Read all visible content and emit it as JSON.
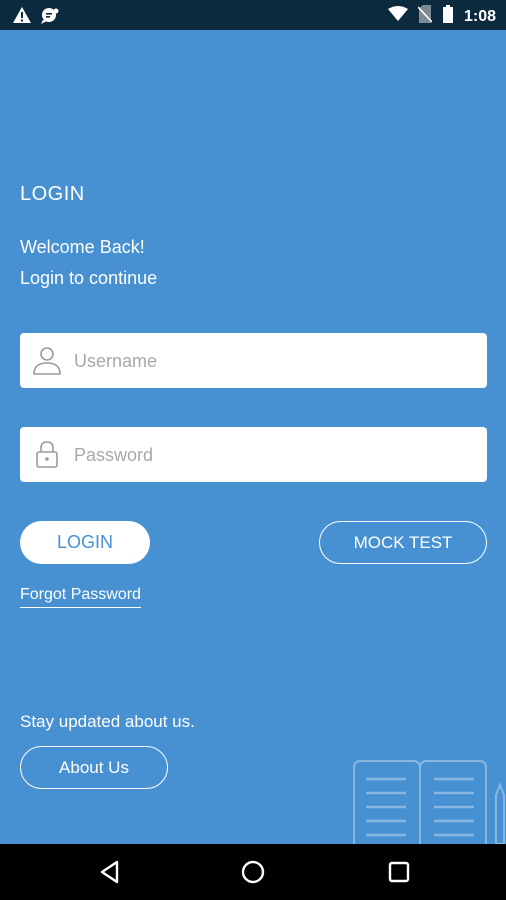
{
  "status_bar": {
    "time": "1:08",
    "icons": [
      "warning-icon",
      "notification-icon",
      "wifi-icon",
      "no-sim-icon",
      "battery-icon"
    ]
  },
  "login": {
    "title": "LOGIN",
    "welcome": "Welcome Back!",
    "subtitle": "Login to continue",
    "username": {
      "placeholder": "Username",
      "value": "",
      "icon": "user-icon"
    },
    "password": {
      "placeholder": "Password",
      "value": "",
      "icon": "lock-icon"
    },
    "login_button": "LOGIN",
    "mock_test_button": "MOCK TEST",
    "forgot_password": "Forgot Password"
  },
  "footer": {
    "stay_updated": "Stay updated about us.",
    "about_button": "About Us"
  },
  "nav_bar": {
    "icons": [
      "back-icon",
      "home-icon",
      "recents-icon"
    ]
  },
  "colors": {
    "background": "#4791d2",
    "status_bar": "#0c2a3e",
    "nav_bar": "#000000",
    "text": "#ffffff"
  }
}
